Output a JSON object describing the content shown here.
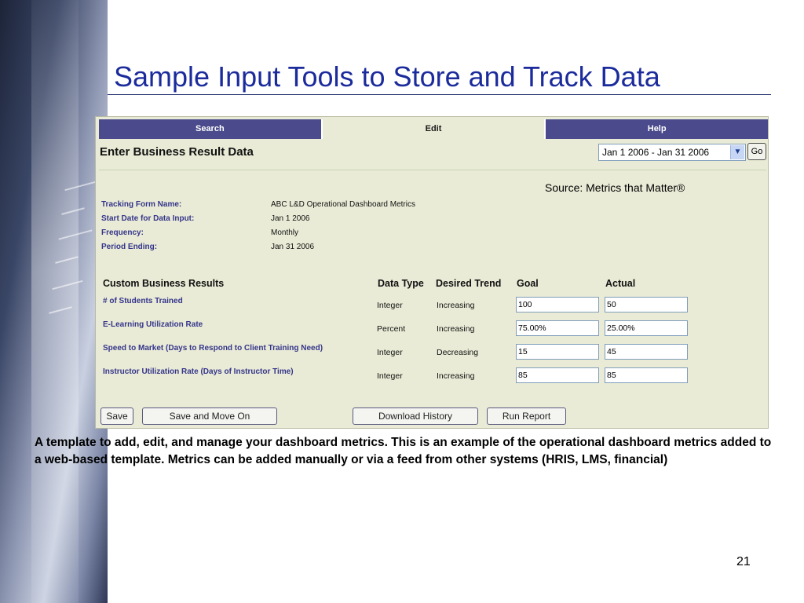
{
  "slide": {
    "title": "Sample Input Tools to Store and Track Data",
    "caption": "A template to add, edit, and manage your dashboard metrics.  This is an example of the operational dashboard metrics added to a web-based template.  Metrics can be added manually or via a feed from other systems (HRIS, LMS, financial)",
    "page_number": "21"
  },
  "app": {
    "tabs": [
      {
        "label": "Search",
        "active": false
      },
      {
        "label": "Edit",
        "active": true
      },
      {
        "label": "Help",
        "active": false
      }
    ],
    "heading": "Enter Business Result Data",
    "period_select": {
      "value": "Jan 1 2006 - Jan 31 2006"
    },
    "go_label": "Go",
    "source_note": "Source: Metrics that Matter®",
    "meta": [
      {
        "label": "Tracking Form Name:",
        "value": "ABC L&D Operational Dashboard Metrics"
      },
      {
        "label": "Start Date for Data Input:",
        "value": "Jan 1 2006"
      },
      {
        "label": "Frequency:",
        "value": "Monthly"
      },
      {
        "label": "Period Ending:",
        "value": "Jan 31 2006"
      }
    ],
    "columns": {
      "name": "Custom Business Results",
      "data_type": "Data Type",
      "trend": "Desired Trend",
      "goal": "Goal",
      "actual": "Actual"
    },
    "rows": [
      {
        "name": "# of Students Trained",
        "data_type": "Integer",
        "trend": "Increasing",
        "goal": "100",
        "actual": "50"
      },
      {
        "name": "E-Learning Utilization Rate",
        "data_type": "Percent",
        "trend": "Increasing",
        "goal": "75.00%",
        "actual": "25.00%"
      },
      {
        "name": "Speed to Market (Days to Respond to Client Training Need)",
        "data_type": "Integer",
        "trend": "Decreasing",
        "goal": "15",
        "actual": "45"
      },
      {
        "name": "Instructor Utilization Rate (Days of Instructor Time)",
        "data_type": "Integer",
        "trend": "Increasing",
        "goal": "85",
        "actual": "85"
      }
    ],
    "buttons": {
      "save": "Save",
      "save_move_on": "Save and Move On",
      "download_history": "Download History",
      "run_report": "Run Report"
    }
  },
  "colors": {
    "title": "#1b2b9c",
    "tab_bar": "#4a4a8c",
    "panel_background": "#e9ebd6",
    "label_text": "#35358a"
  }
}
